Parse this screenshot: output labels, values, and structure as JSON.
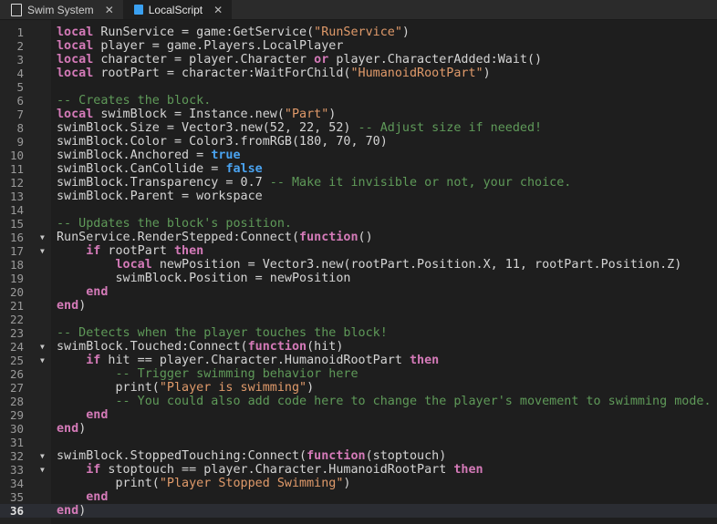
{
  "tabs": [
    {
      "label": "Swim System",
      "icon": "server-script-icon",
      "active": false
    },
    {
      "label": "LocalScript",
      "icon": "local-script-icon",
      "active": true
    }
  ],
  "close_glyph": "✕",
  "current_line": 36,
  "folds": [
    16,
    17,
    24,
    25,
    32,
    33
  ],
  "lines": [
    [
      [
        "k",
        "local"
      ],
      [
        "i",
        " RunService = game:GetService("
      ],
      [
        "s",
        "\"RunService\""
      ],
      [
        "i",
        ")"
      ]
    ],
    [
      [
        "k",
        "local"
      ],
      [
        "i",
        " player = game.Players.LocalPlayer"
      ]
    ],
    [
      [
        "k",
        "local"
      ],
      [
        "i",
        " character = player.Character "
      ],
      [
        "k",
        "or"
      ],
      [
        "i",
        " player.CharacterAdded:Wait()"
      ]
    ],
    [
      [
        "k",
        "local"
      ],
      [
        "i",
        " rootPart = character:WaitForChild("
      ],
      [
        "s",
        "\"HumanoidRootPart\""
      ],
      [
        "i",
        ")"
      ]
    ],
    [],
    [
      [
        "c",
        "-- Creates the block."
      ]
    ],
    [
      [
        "k",
        "local"
      ],
      [
        "i",
        " swimBlock = Instance.new("
      ],
      [
        "s",
        "\"Part\""
      ],
      [
        "i",
        ")"
      ]
    ],
    [
      [
        "i",
        "swimBlock.Size = Vector3.new(52, 22, 52) "
      ],
      [
        "c",
        "-- Adjust size if needed!"
      ]
    ],
    [
      [
        "i",
        "swimBlock.Color = Color3.fromRGB(180, 70, 70)"
      ]
    ],
    [
      [
        "i",
        "swimBlock.Anchored = "
      ],
      [
        "b",
        "true"
      ]
    ],
    [
      [
        "i",
        "swimBlock.CanCollide = "
      ],
      [
        "b",
        "false"
      ]
    ],
    [
      [
        "i",
        "swimBlock.Transparency = 0.7 "
      ],
      [
        "c",
        "-- Make it invisible or not, your choice."
      ]
    ],
    [
      [
        "i",
        "swimBlock.Parent = workspace"
      ]
    ],
    [],
    [
      [
        "c",
        "-- Updates the block's position."
      ]
    ],
    [
      [
        "i",
        "RunService.RenderStepped:Connect("
      ],
      [
        "k",
        "function"
      ],
      [
        "i",
        "()"
      ]
    ],
    [
      [
        "i",
        "    "
      ],
      [
        "k",
        "if"
      ],
      [
        "i",
        " rootPart "
      ],
      [
        "k",
        "then"
      ]
    ],
    [
      [
        "i",
        "        "
      ],
      [
        "k",
        "local"
      ],
      [
        "i",
        " newPosition = Vector3.new(rootPart.Position.X, 11, rootPart.Position.Z)"
      ]
    ],
    [
      [
        "i",
        "        swimBlock.Position = newPosition"
      ]
    ],
    [
      [
        "i",
        "    "
      ],
      [
        "k",
        "end"
      ]
    ],
    [
      [
        "k",
        "end"
      ],
      [
        "i",
        ")"
      ]
    ],
    [],
    [
      [
        "c",
        "-- Detects when the player touches the block!"
      ]
    ],
    [
      [
        "i",
        "swimBlock.Touched:Connect("
      ],
      [
        "k",
        "function"
      ],
      [
        "i",
        "(hit)"
      ]
    ],
    [
      [
        "i",
        "    "
      ],
      [
        "k",
        "if"
      ],
      [
        "i",
        " hit == player.Character.HumanoidRootPart "
      ],
      [
        "k",
        "then"
      ]
    ],
    [
      [
        "i",
        "        "
      ],
      [
        "c",
        "-- Trigger swimming behavior here"
      ]
    ],
    [
      [
        "i",
        "        print("
      ],
      [
        "s",
        "\"Player is swimming\""
      ],
      [
        "i",
        ")"
      ]
    ],
    [
      [
        "i",
        "        "
      ],
      [
        "c",
        "-- You could also add code here to change the player's movement to swimming mode."
      ]
    ],
    [
      [
        "i",
        "    "
      ],
      [
        "k",
        "end"
      ]
    ],
    [
      [
        "k",
        "end"
      ],
      [
        "i",
        ")"
      ]
    ],
    [],
    [
      [
        "i",
        "swimBlock.StoppedTouching:Connect("
      ],
      [
        "k",
        "function"
      ],
      [
        "i",
        "(stoptouch)"
      ]
    ],
    [
      [
        "i",
        "    "
      ],
      [
        "k",
        "if"
      ],
      [
        "i",
        " stoptouch == player.Character.HumanoidRootPart "
      ],
      [
        "k",
        "then"
      ]
    ],
    [
      [
        "i",
        "        print("
      ],
      [
        "s",
        "\"Player Stopped Swimming\""
      ],
      [
        "i",
        ")"
      ]
    ],
    [
      [
        "i",
        "    "
      ],
      [
        "k",
        "end"
      ]
    ],
    [
      [
        "k",
        "end"
      ],
      [
        "i",
        ")"
      ]
    ]
  ]
}
